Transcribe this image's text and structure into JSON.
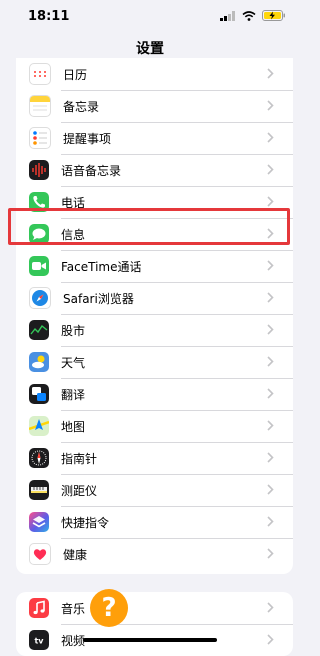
{
  "status_bar": {
    "time": "18:11"
  },
  "nav": {
    "title": "设置"
  },
  "group1": [
    {
      "label": "日历",
      "icon": "calendar-icon",
      "color": "#ffffff"
    },
    {
      "label": "备忘录",
      "icon": "notes-icon",
      "color": "#ffd43b"
    },
    {
      "label": "提醒事项",
      "icon": "reminders-icon",
      "color": "#ffffff"
    },
    {
      "label": "语音备忘录",
      "icon": "voice-memos-icon",
      "color": "#1c1c1e"
    },
    {
      "label": "电话",
      "icon": "phone-icon",
      "color": "#34c759"
    },
    {
      "label": "信息",
      "icon": "messages-icon",
      "color": "#34c759"
    },
    {
      "label": "FaceTime通话",
      "icon": "facetime-icon",
      "color": "#34c759"
    },
    {
      "label": "Safari浏览器",
      "icon": "safari-icon",
      "color": "#1e88e5"
    },
    {
      "label": "股市",
      "icon": "stocks-icon",
      "color": "#1c1c1e"
    },
    {
      "label": "天气",
      "icon": "weather-icon",
      "color": "#4a90e2"
    },
    {
      "label": "翻译",
      "icon": "translate-icon",
      "color": "#1c1c1e"
    },
    {
      "label": "地图",
      "icon": "maps-icon",
      "color": "#8ed081"
    },
    {
      "label": "指南针",
      "icon": "compass-icon",
      "color": "#1c1c1e"
    },
    {
      "label": "测距仪",
      "icon": "measure-icon",
      "color": "#1c1c1e"
    },
    {
      "label": "快捷指令",
      "icon": "shortcuts-icon",
      "color": "#5e5ce6"
    },
    {
      "label": "健康",
      "icon": "health-icon",
      "color": "#ffffff"
    }
  ],
  "group2": [
    {
      "label": "音乐",
      "icon": "music-icon",
      "color": "#fc3c44"
    },
    {
      "label": "视频",
      "icon": "tv-icon",
      "color": "#1c1c1e"
    }
  ],
  "help_badge": "?",
  "highlight_color": "#e5383b"
}
